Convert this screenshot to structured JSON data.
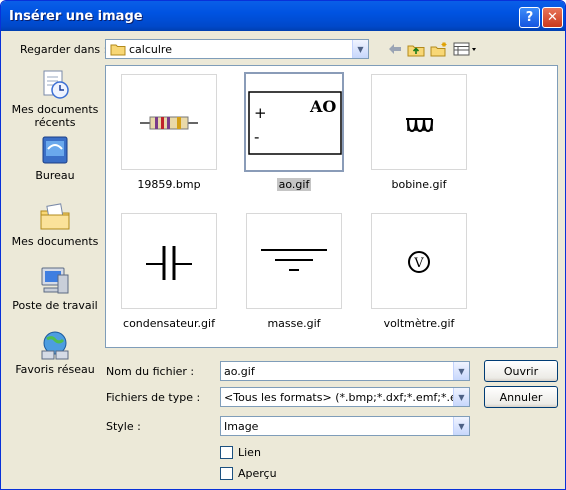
{
  "window": {
    "title": "Insérer une image"
  },
  "lookin": {
    "label": "Regarder dans :",
    "value": "calculre"
  },
  "places": [
    {
      "label": "Mes documents récents",
      "icon": "recent-documents-icon"
    },
    {
      "label": "Bureau",
      "icon": "desktop-icon"
    },
    {
      "label": "Mes documents",
      "icon": "my-documents-icon"
    },
    {
      "label": "Poste de travail",
      "icon": "my-computer-icon"
    },
    {
      "label": "Favoris réseau",
      "icon": "network-places-icon"
    }
  ],
  "files": [
    {
      "name": "19859.bmp",
      "icon": "resistor-thumbnail"
    },
    {
      "name": "ao.gif",
      "icon": "op-amp-thumbnail",
      "selected": true,
      "thumb_text": {
        "title": "AO",
        "plus": "+",
        "minus": "-"
      }
    },
    {
      "name": "bobine.gif",
      "icon": "coil-thumbnail"
    },
    {
      "name": "condensateur.gif",
      "icon": "capacitor-thumbnail"
    },
    {
      "name": "masse.gif",
      "icon": "ground-thumbnail"
    },
    {
      "name": "voltmètre.gif",
      "icon": "voltmeter-thumbnail",
      "thumb_text": "V"
    }
  ],
  "form": {
    "filename_label": "Nom du fichier :",
    "filename_value": "ao.gif",
    "filetype_label": "Fichiers de type :",
    "filetype_value": "<Tous les formats> (*.bmp;*.dxf;*.emf;*.eps;*.gif;*",
    "style_label": "Style :",
    "style_value": "Image",
    "link_label": "Lien",
    "preview_label": "Aperçu"
  },
  "buttons": {
    "open": "Ouvrir",
    "cancel": "Annuler"
  },
  "colors": {
    "titlebar": "#0053e1",
    "dialog_bg": "#ece9d8",
    "selection": "#c5c5c5"
  }
}
